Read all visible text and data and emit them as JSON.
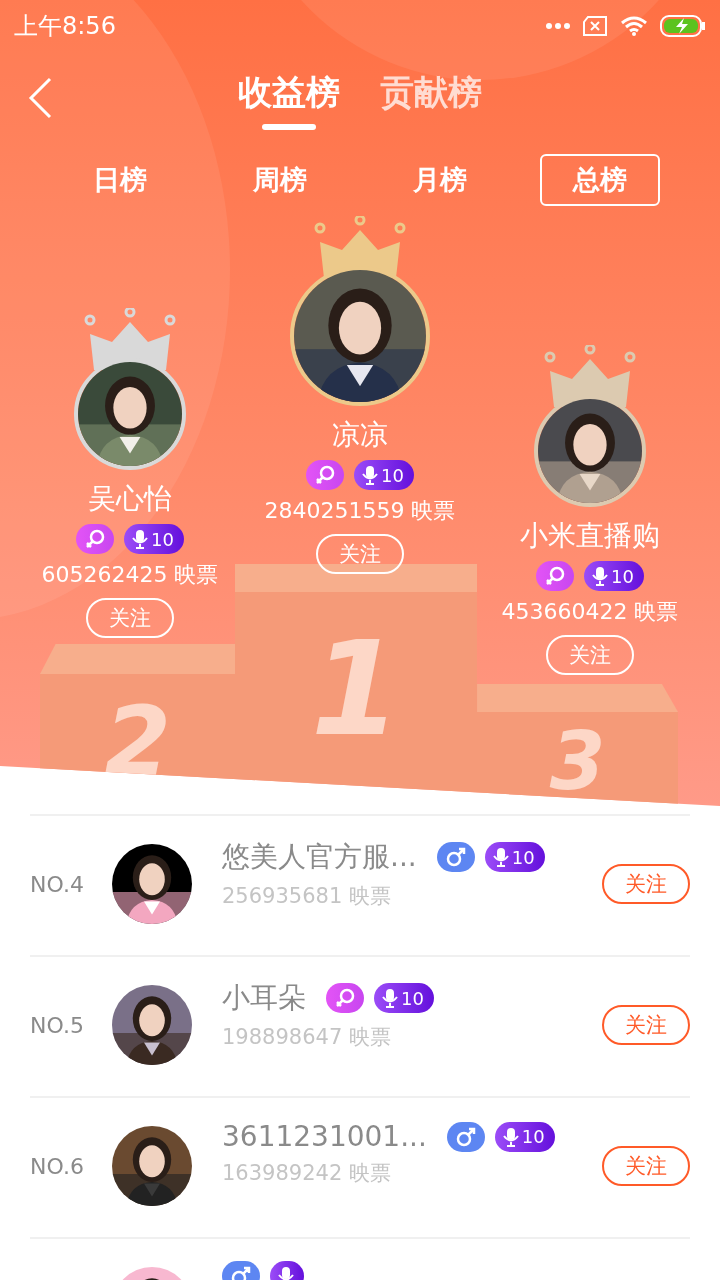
{
  "status_bar": {
    "time": "上午8:56"
  },
  "main_tabs": [
    {
      "label": "收益榜",
      "selected": true
    },
    {
      "label": "贡献榜",
      "selected": false
    }
  ],
  "period_tabs": [
    {
      "label": "日榜",
      "selected": false
    },
    {
      "label": "周榜",
      "selected": false
    },
    {
      "label": "月榜",
      "selected": false
    },
    {
      "label": "总榜",
      "selected": true
    }
  ],
  "top3": [
    {
      "rank": "2",
      "name": "吴心怡",
      "kind": "female",
      "level": "10",
      "votes": "605262425 映票",
      "follow": "关注"
    },
    {
      "rank": "1",
      "name": "凉凉",
      "kind": "female",
      "level": "10",
      "votes": "2840251559 映票",
      "follow": "关注"
    },
    {
      "rank": "3",
      "name": "小米直播购",
      "kind": "female",
      "level": "10",
      "votes": "453660422 映票",
      "follow": "关注"
    }
  ],
  "list": [
    {
      "rank": "NO.4",
      "name": "悠美人官方服...",
      "kind": "male",
      "level": "10",
      "votes": "256935681 映票",
      "follow": "关注"
    },
    {
      "rank": "NO.5",
      "name": "小耳朵",
      "kind": "female",
      "level": "10",
      "votes": "198898647 映票",
      "follow": "关注"
    },
    {
      "rank": "NO.6",
      "name": "3611231001...",
      "kind": "male",
      "level": "10",
      "votes": "163989242 映票",
      "follow": "关注"
    },
    {
      "kind": "male"
    }
  ]
}
